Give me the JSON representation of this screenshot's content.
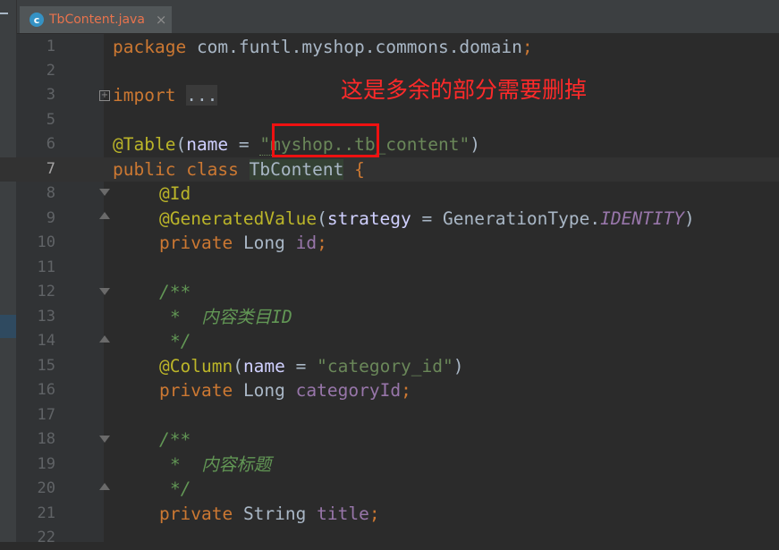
{
  "tab": {
    "icon": "c",
    "filename": "TbContent.java",
    "close": "×"
  },
  "lines": [
    {
      "n": "1",
      "text": "package com.funtl.myshop.commons.domain;"
    },
    {
      "n": "2",
      "text": ""
    },
    {
      "n": "3",
      "text": "import ..."
    },
    {
      "n": "5",
      "text": ""
    },
    {
      "n": "6",
      "text": "@Table(name = \"myshop..tb_content\")"
    },
    {
      "n": "7",
      "text": "public class TbContent {"
    },
    {
      "n": "8",
      "text": "@Id"
    },
    {
      "n": "9",
      "text": "@GeneratedValue(strategy = GenerationType.IDENTITY)"
    },
    {
      "n": "10",
      "text": "private Long id;"
    },
    {
      "n": "11",
      "text": ""
    },
    {
      "n": "12",
      "text": "/**"
    },
    {
      "n": "13",
      "text": "* 内容类目ID"
    },
    {
      "n": "14",
      "text": "*/"
    },
    {
      "n": "15",
      "text": "@Column(name = \"category_id\")"
    },
    {
      "n": "16",
      "text": "private Long categoryId;"
    },
    {
      "n": "17",
      "text": ""
    },
    {
      "n": "18",
      "text": "/**"
    },
    {
      "n": "19",
      "text": "* 内容标题"
    },
    {
      "n": "20",
      "text": "*/"
    },
    {
      "n": "21",
      "text": "private String title;"
    },
    {
      "n": "22",
      "text": ""
    }
  ],
  "tokens": {
    "package": "package",
    "pkg_name": "com.funtl.myshop.commons.domain",
    "semi": ";",
    "import": "import",
    "import_folded": "...",
    "table_ann": "@Table",
    "name_param": "name",
    "eq": " = ",
    "table_str_a": "\"myshop..",
    "table_str_b": "tb_content\"",
    "public": "public",
    "class": "class",
    "class_name": "TbContent",
    "brace": "{",
    "id_ann": "@Id",
    "gen_ann": "@GeneratedValue",
    "strategy_param": "strategy",
    "gen_type": "GenerationType.",
    "identity": "IDENTITY",
    "private": "private",
    "long_type": "Long",
    "string_type": "String",
    "id_field": "id",
    "category_field": "categoryId",
    "title_field": "title",
    "doc_open": "/**",
    "doc_close": "*/",
    "doc_category": "*  内容类目ID",
    "doc_title": "*  内容标题",
    "column_ann": "@Column",
    "category_str": "\"category_id\""
  },
  "annotation": {
    "callout_text": "这是多余的部分需要删掉",
    "callout_color": "#ff2a2a"
  },
  "colors": {
    "keyword": "#cc7832",
    "annotation": "#bbb529",
    "string": "#6a8759",
    "field": "#9876aa",
    "doc": "#629755",
    "background": "#2b2b2b"
  }
}
